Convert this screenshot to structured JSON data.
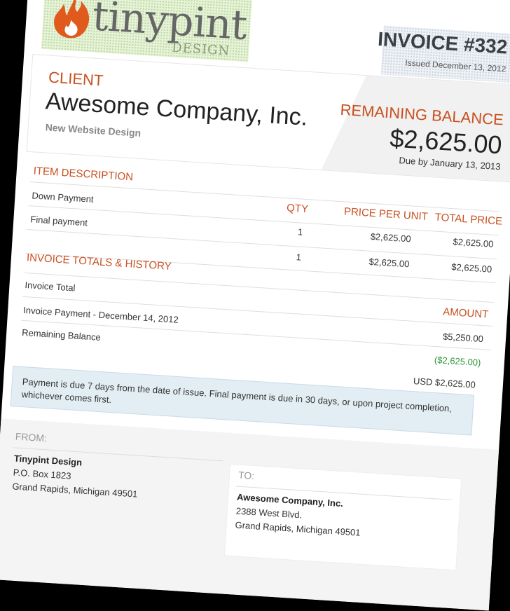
{
  "header": {
    "logo_word": "tinypint",
    "logo_sub": "DESIGN",
    "invoice_number": "INVOICE #332",
    "issued": "Issued December 13, 2012"
  },
  "client": {
    "label": "CLIENT",
    "name": "Awesome Company, Inc.",
    "project": "New Website Design"
  },
  "balance": {
    "label": "REMAINING BALANCE",
    "amount": "$2,625.00",
    "due": "Due by January 13, 2013"
  },
  "items": {
    "headers": {
      "description": "ITEM DESCRIPTION",
      "qty": "QTY",
      "price": "PRICE PER UNIT",
      "total": "TOTAL PRICE"
    },
    "rows": [
      {
        "description": "Down Payment",
        "qty": "1",
        "price": "$2,625.00",
        "total": "$2,625.00"
      },
      {
        "description": "Final payment",
        "qty": "1",
        "price": "$2,625.00",
        "total": "$2,625.00"
      }
    ]
  },
  "totals": {
    "title": "INVOICE TOTALS & HISTORY",
    "amount_header": "AMOUNT",
    "rows": [
      {
        "label": "Invoice Total",
        "amount": "$5,250.00"
      },
      {
        "label": "Invoice Payment - December 14, 2012",
        "amount": "($2,625.00)",
        "color": "#2f9a3a"
      },
      {
        "label": "Remaining Balance",
        "amount": "USD $2,625.00"
      }
    ]
  },
  "note": "Payment is due 7 days from the date of issue. Final payment is due in 30 days, or upon project completion, whichever comes first.",
  "from": {
    "label": "FROM:",
    "name": "Tinypint Design",
    "line1": "P.O. Box 1823",
    "line2": "Grand Rapids, Michigan 49501"
  },
  "to": {
    "label": "TO:",
    "name": "Awesome Company, Inc.",
    "line1": "2388 West Blvd.",
    "line2": "Grand Rapids, Michigan 49501"
  },
  "colors": {
    "accent": "#c8501f",
    "paid": "#2f9a3a",
    "note_bg": "#e3eef4"
  }
}
